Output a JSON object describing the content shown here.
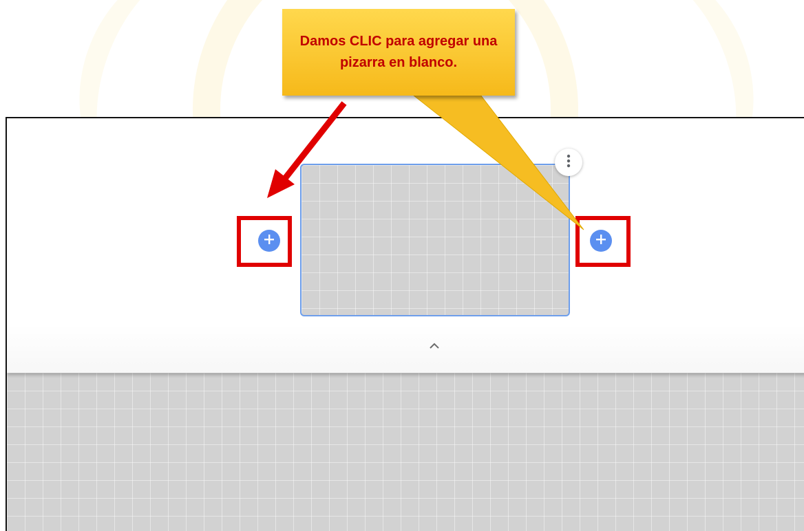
{
  "callout": {
    "text": "Damos CLIC para agregar una pizarra en blanco."
  },
  "colors": {
    "callout_fill": "#f8c52a",
    "callout_text": "#c00000",
    "highlight": "#e00000",
    "arrow": "#e00000",
    "accent_blue": "#5b8ff0",
    "thumb_border": "#6d9eeb",
    "canvas_grid": "#d2d2d2"
  },
  "icons": {
    "more": "more-vertical-icon",
    "add": "plus-circle-icon",
    "collapse": "chevron-up-icon"
  }
}
